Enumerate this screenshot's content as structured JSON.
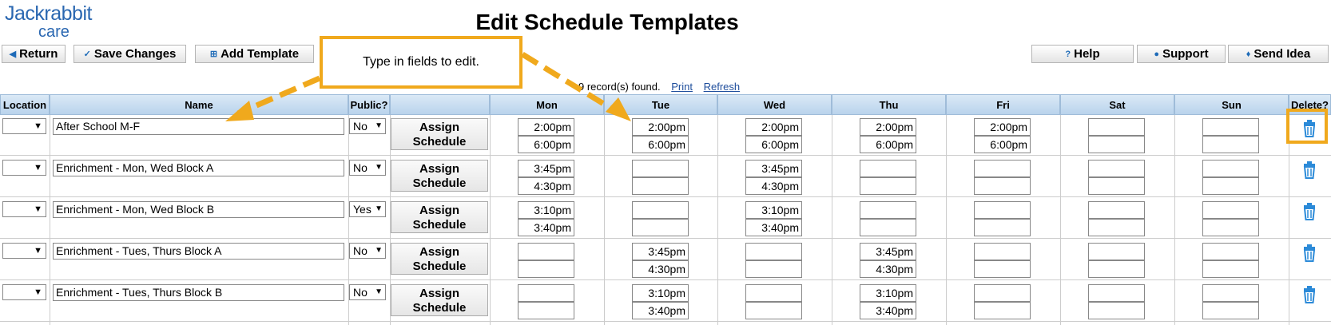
{
  "logo": {
    "line1": "Jackrabbit",
    "line2": "care"
  },
  "page_title": "Edit Schedule Templates",
  "toolbar": {
    "return_label": "Return",
    "save_label": "Save Changes",
    "add_label": "Add Template",
    "help_label": "Help",
    "support_label": "Support",
    "idea_label": "Send Idea"
  },
  "callout_text": "Type in fields to edit.",
  "records": {
    "count_text": "9 record(s) found.",
    "print_label": "Print",
    "refresh_label": "Refresh"
  },
  "columns": {
    "location": "Location",
    "name": "Name",
    "public": "Public?",
    "mon": "Mon",
    "tue": "Tue",
    "wed": "Wed",
    "thu": "Thu",
    "fri": "Fri",
    "sat": "Sat",
    "sun": "Sun",
    "delete": "Delete?"
  },
  "assign_label": "Assign Schedule",
  "rows": [
    {
      "name": "After School M-F",
      "public": "No",
      "mon": [
        "2:00pm",
        "6:00pm"
      ],
      "tue": [
        "2:00pm",
        "6:00pm"
      ],
      "wed": [
        "2:00pm",
        "6:00pm"
      ],
      "thu": [
        "2:00pm",
        "6:00pm"
      ],
      "fri": [
        "2:00pm",
        "6:00pm"
      ],
      "sat": [
        "",
        ""
      ],
      "sun": [
        "",
        ""
      ]
    },
    {
      "name": "Enrichment - Mon, Wed Block A",
      "public": "No",
      "mon": [
        "3:45pm",
        "4:30pm"
      ],
      "tue": [
        "",
        ""
      ],
      "wed": [
        "3:45pm",
        "4:30pm"
      ],
      "thu": [
        "",
        ""
      ],
      "fri": [
        "",
        ""
      ],
      "sat": [
        "",
        ""
      ],
      "sun": [
        "",
        ""
      ]
    },
    {
      "name": "Enrichment - Mon, Wed Block B",
      "public": "Yes",
      "mon": [
        "3:10pm",
        "3:40pm"
      ],
      "tue": [
        "",
        ""
      ],
      "wed": [
        "3:10pm",
        "3:40pm"
      ],
      "thu": [
        "",
        ""
      ],
      "fri": [
        "",
        ""
      ],
      "sat": [
        "",
        ""
      ],
      "sun": [
        "",
        ""
      ]
    },
    {
      "name": "Enrichment - Tues, Thurs Block A",
      "public": "No",
      "mon": [
        "",
        ""
      ],
      "tue": [
        "3:45pm",
        "4:30pm"
      ],
      "wed": [
        "",
        ""
      ],
      "thu": [
        "3:45pm",
        "4:30pm"
      ],
      "fri": [
        "",
        ""
      ],
      "sat": [
        "",
        ""
      ],
      "sun": [
        "",
        ""
      ]
    },
    {
      "name": "Enrichment - Tues, Thurs Block B",
      "public": "No",
      "mon": [
        "",
        ""
      ],
      "tue": [
        "3:10pm",
        "3:40pm"
      ],
      "wed": [
        "",
        ""
      ],
      "thu": [
        "3:10pm",
        "3:40pm"
      ],
      "fri": [
        "",
        ""
      ],
      "sat": [
        "",
        ""
      ],
      "sun": [
        "",
        ""
      ]
    }
  ],
  "icons": {
    "trash": "trash-icon",
    "dropdown": "caret-down-icon",
    "return": "caret-left-icon",
    "save": "checkmark-icon",
    "add": "plus-box-icon",
    "help": "question-icon",
    "support": "person-icon",
    "idea": "lightbulb-icon"
  },
  "colors": {
    "accent": "#f0a91d",
    "brand": "#2a67b1",
    "header": "#c9def2"
  }
}
